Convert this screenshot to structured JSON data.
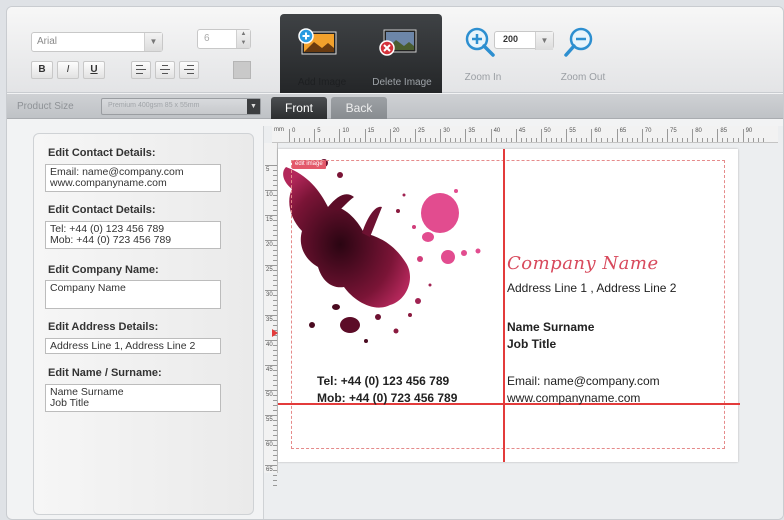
{
  "toolbar": {
    "font": "Arial",
    "font_size": "6",
    "format": {
      "bold": "B",
      "italic": "I",
      "underline": "U"
    },
    "add_image_label": "Add Image",
    "delete_image_label": "Delete Image",
    "zoom_in_label": "Zoom In",
    "zoom_out_label": "Zoom Out",
    "zoom_value": "200"
  },
  "product": {
    "label": "Product Size",
    "value": "Premium 400gsm 85 x 55mm"
  },
  "tabs": {
    "front": "Front",
    "back": "Back"
  },
  "fields": [
    {
      "label": "Edit Contact Details:",
      "lines": [
        "Email: name@company.com",
        "www.companyname.com"
      ]
    },
    {
      "label": "Edit Contact Details:",
      "lines": [
        "Tel: +44 (0) 123 456 789",
        "Mob: +44 (0) 723 456 789"
      ]
    },
    {
      "label": "Edit Company Name:",
      "lines": [
        "Company Name"
      ]
    },
    {
      "label": "Edit Address Details:",
      "lines": [
        "Address Line 1, Address Line 2"
      ]
    },
    {
      "label": "Edit Name / Surname:",
      "lines": [
        "Name Surname",
        "Job Title"
      ]
    }
  ],
  "ruler": {
    "unit": "mm",
    "top_labels": [
      "0",
      "5",
      "10",
      "15",
      "20",
      "25",
      "30",
      "35",
      "40",
      "45",
      "50",
      "55",
      "60",
      "65",
      "70",
      "75",
      "80",
      "85",
      "90"
    ],
    "left_labels": [
      "5",
      "10",
      "15",
      "20",
      "25",
      "30",
      "35",
      "40",
      "45",
      "50",
      "55",
      "60",
      "65"
    ]
  },
  "card": {
    "edit_tag": "edit image",
    "company": "Company Name",
    "address": "Address Line 1 , Address Line 2",
    "name": "Name Surname",
    "job": "Job Title",
    "tel": "Tel: +44 (0) 123 456 789",
    "mob": "Mob: +44 (0) 723 456 789",
    "email": "Email: name@company.com",
    "web": "www.companyname.com"
  },
  "colors": {
    "accent": "#e33b3b",
    "company_text": "#d8495c",
    "ink": "#6b0f2a",
    "ink_pink": "#e24c8f"
  }
}
